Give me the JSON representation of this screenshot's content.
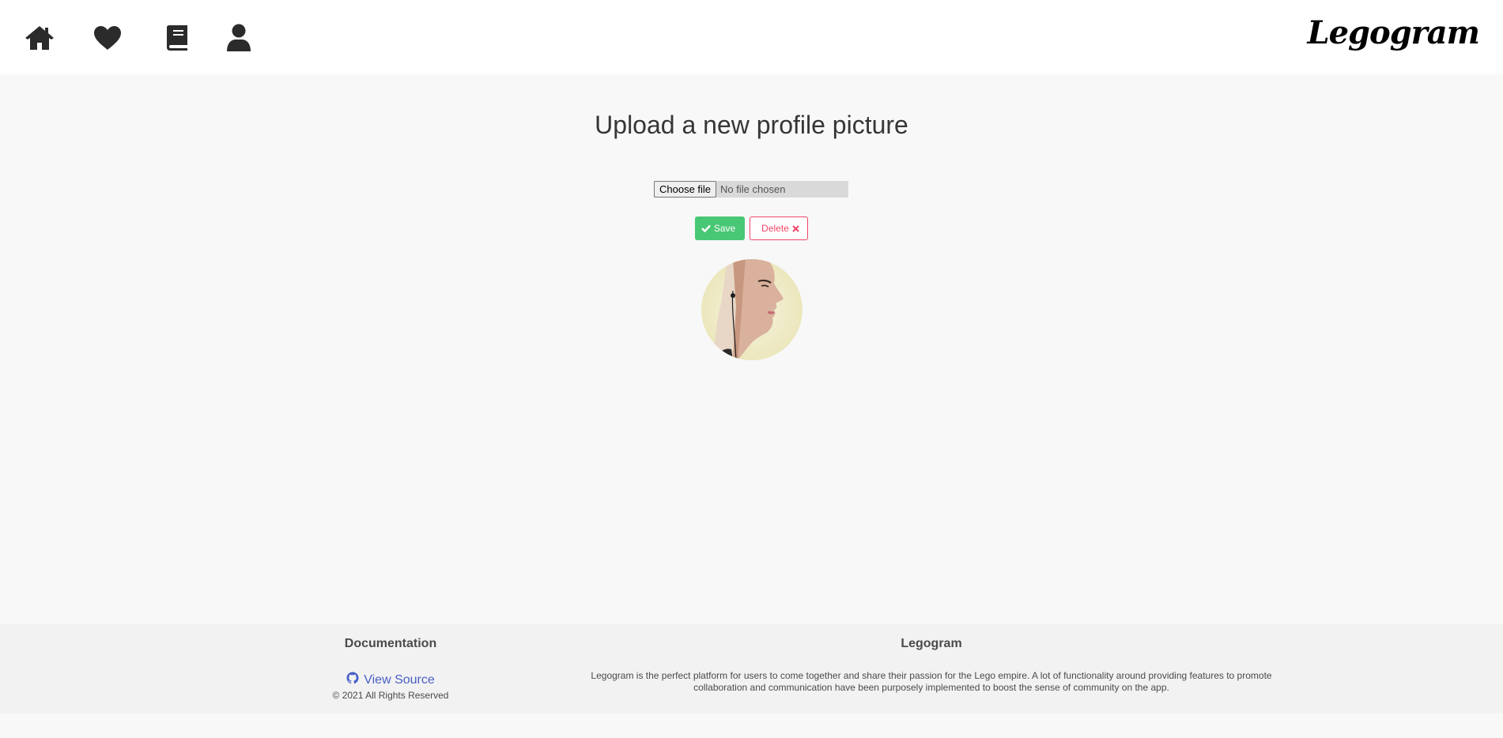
{
  "nav": {
    "icons": [
      "home-icon",
      "heart-icon",
      "book-icon",
      "user-icon"
    ],
    "brand": "Legogram"
  },
  "main": {
    "title": "Upload a new profile picture",
    "file_input": {
      "button_label": "Choose file",
      "status": "No file chosen"
    },
    "save_label": "Save",
    "delete_label": "Delete"
  },
  "footer": {
    "documentation_title": "Documentation",
    "view_source_label": "View Source",
    "copyright": "© 2021 All Rights Reserved",
    "legogram_title": "Legogram",
    "description": "Legogram is the perfect platform for users to come together and share their passion for the Lego empire. A lot of functionality around providing features to promote collaboration and communication have been purposely implemented to boost the sense of community on the app."
  },
  "colors": {
    "save": "#48c774",
    "delete": "#f14668",
    "link": "#485fc7",
    "page_bg": "#f8f8f8",
    "footer_bg": "#f2f2f2"
  }
}
